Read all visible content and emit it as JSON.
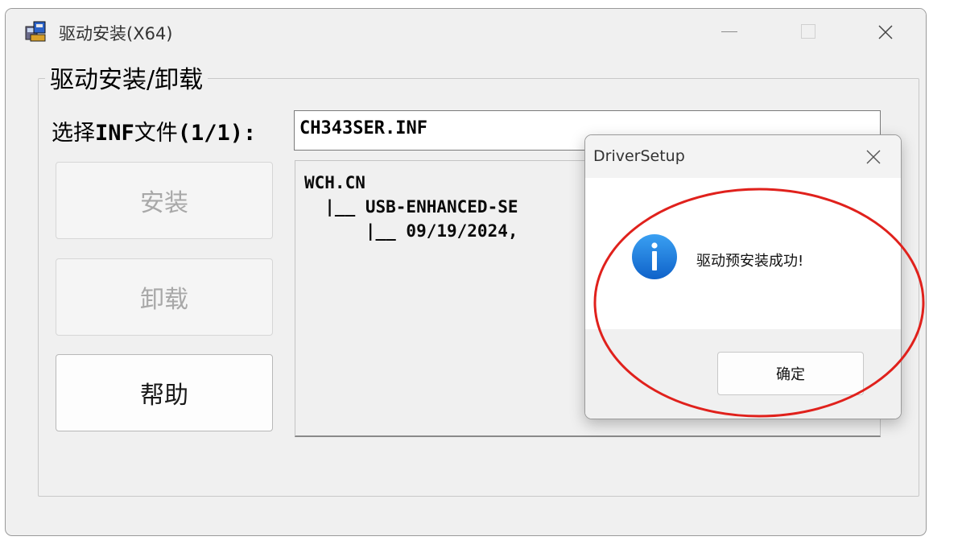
{
  "window": {
    "title": "驱动安装(X64)",
    "icon": "installer-icon",
    "controls": [
      "minimize-icon",
      "maximize-icon",
      "close-icon"
    ]
  },
  "group": {
    "title": "驱动安装/卸载"
  },
  "inf": {
    "label_prefix": "选择",
    "label_mono": "INF",
    "label_mid": "文件",
    "label_suffix": "(1/1):",
    "value": "CH343SER.INF"
  },
  "buttons": {
    "install": "安装",
    "uninstall": "卸载",
    "help": "帮助"
  },
  "tree": {
    "lines": [
      "WCH.CN",
      "  |__ USB-ENHANCED-SE",
      "      |__ 09/19/2024,"
    ]
  },
  "dialog": {
    "title": "DriverSetup",
    "icon": "info-icon",
    "message": "驱动预安装成功!",
    "ok_label": "确定"
  },
  "colors": {
    "window_bg": "#f0f0f0",
    "info_blue": "#1f7fe0",
    "highlight_red": "#e0211c"
  }
}
